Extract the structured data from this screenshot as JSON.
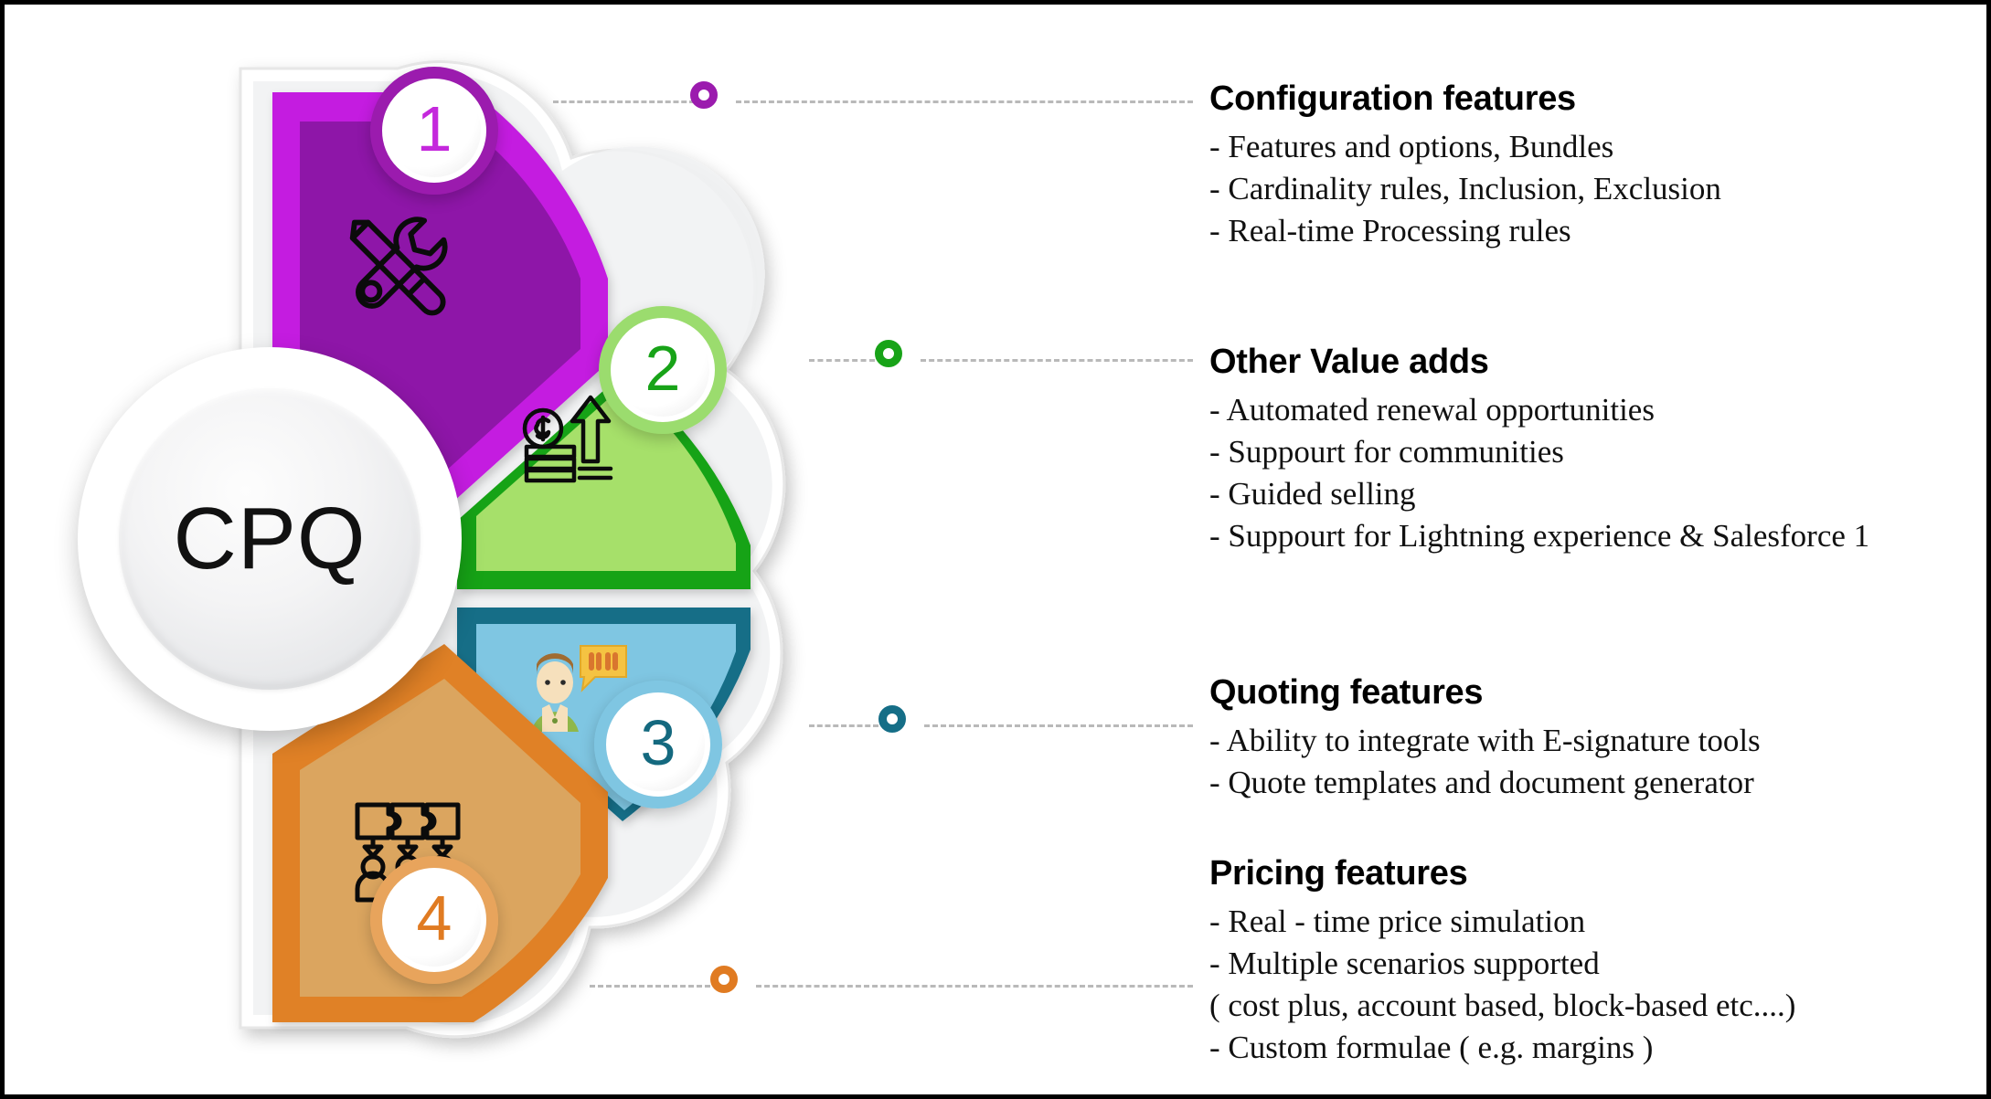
{
  "hub": {
    "label": "CPQ"
  },
  "segments": [
    {
      "number": "1",
      "icon": "tools-icon",
      "color_outer": "#C41FE0",
      "color_inner": "#8E18A8",
      "ring_color": "#9B1BAE",
      "number_color": "#C428DC"
    },
    {
      "number": "2",
      "icon": "money-growth-icon",
      "color_outer": "#18A318",
      "color_inner": "#A6E06B",
      "ring_color": "#9BDC6E",
      "number_color": "#18A318"
    },
    {
      "number": "3",
      "icon": "person-speech-bubble-icon",
      "color_outer": "#156E87",
      "color_inner": "#7FC6E2",
      "ring_color": "#7FC6E2",
      "number_color": "#14697F"
    },
    {
      "number": "4",
      "icon": "team-puzzle-icon",
      "color_outer": "#E08128",
      "color_inner": "#DBA55E",
      "ring_color": "#E8A45C",
      "number_color": "#E07B22"
    }
  ],
  "connectors": [
    {
      "name": "connector-1",
      "color": "#9B1BAE"
    },
    {
      "name": "connector-2",
      "color": "#18A318"
    },
    {
      "name": "connector-3",
      "color": "#156E87"
    },
    {
      "name": "connector-4",
      "color": "#E07B22"
    }
  ],
  "panel": {
    "blocks": [
      {
        "title": "Configuration features",
        "items": [
          "- Features and options, Bundles",
          "- Cardinality rules, Inclusion, Exclusion",
          "- Real-time Processing rules"
        ]
      },
      {
        "title": "Other Value adds",
        "items": [
          "- Automated renewal opportunities",
          "- Suppourt for communities",
          "- Guided selling",
          "- Suppourt for Lightning experience & Salesforce 1"
        ]
      },
      {
        "title": "Quoting features",
        "items": [
          "- Ability to integrate with E-signature tools",
          "- Quote templates and document generator"
        ]
      },
      {
        "title": "Pricing features",
        "items": [
          "- Real - time price simulation",
          "- Multiple scenarios supported",
          " ( cost plus, account based, block-based etc....)",
          "- Custom formulae ( e.g. margins )"
        ]
      }
    ]
  }
}
